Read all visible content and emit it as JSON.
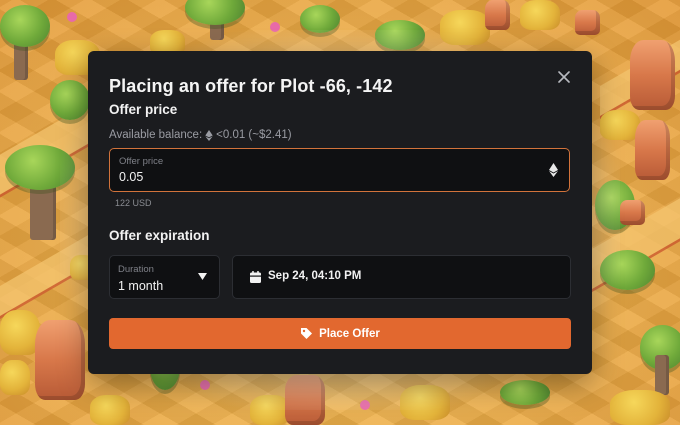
{
  "modal": {
    "title": "Placing an offer for Plot -66, -142",
    "close_icon": "close-icon"
  },
  "offer_price": {
    "section_label": "Offer price",
    "balance_prefix": "Available balance:",
    "balance_value": "<0.01 (~$2.41)",
    "field_label": "Offer price",
    "value": "0.05",
    "currency_icon": "ethereum-icon",
    "usd_equivalent": "122 USD"
  },
  "expiration": {
    "section_label": "Offer expiration",
    "duration_label": "Duration",
    "duration_value": "1 month",
    "date_value": "Sep 24, 04:10 PM",
    "date_icon": "calendar-icon"
  },
  "action": {
    "label": "Place Offer",
    "icon": "tag-icon"
  },
  "colors": {
    "modal_bg": "#1b1c1f",
    "accent": "#e2682f",
    "focus_border": "#d2733b",
    "field_bg": "#0f1012"
  }
}
